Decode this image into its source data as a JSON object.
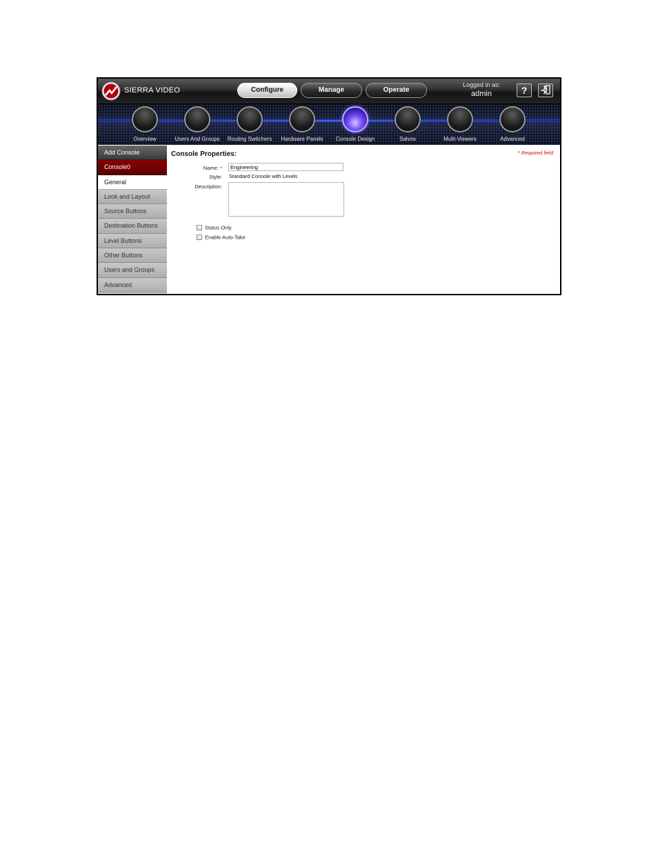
{
  "header": {
    "brand": "SIERRA VIDEO",
    "tabs": [
      {
        "label": "Configure",
        "active": true
      },
      {
        "label": "Manage",
        "active": false
      },
      {
        "label": "Operate",
        "active": false
      }
    ],
    "login_label": "Logged in as:",
    "login_user": "admin",
    "help_icon": "?",
    "logout_icon": "exit-running-man-icon"
  },
  "nav": {
    "items": [
      {
        "label": "Overview",
        "active": false
      },
      {
        "label": "Users And Groups",
        "active": false
      },
      {
        "label": "Routing Switchers",
        "active": false
      },
      {
        "label": "Hardware Panels",
        "active": false
      },
      {
        "label": "Console Design",
        "active": true
      },
      {
        "label": "Salvos",
        "active": false
      },
      {
        "label": "Multi-Viewers",
        "active": false
      },
      {
        "label": "Advanced",
        "active": false
      }
    ]
  },
  "sidebar": {
    "items": [
      {
        "label": "Add Console",
        "state": "head"
      },
      {
        "label": "Console0",
        "state": "sel"
      },
      {
        "label": "General",
        "state": "active"
      },
      {
        "label": "Look and Layout",
        "state": "normal"
      },
      {
        "label": "Source Buttons",
        "state": "normal"
      },
      {
        "label": "Destination Buttons",
        "state": "normal"
      },
      {
        "label": "Level Buttons",
        "state": "normal"
      },
      {
        "label": "Other Buttons",
        "state": "normal"
      },
      {
        "label": "Users and Groups",
        "state": "normal"
      },
      {
        "label": "Advanced",
        "state": "normal"
      }
    ]
  },
  "content": {
    "title": "Console Properties:",
    "required_note": "* Required field",
    "name_label": "Name:",
    "name_required": "*",
    "name_value": "Engineering",
    "style_label": "Style:",
    "style_value": "Standard Console with Levels",
    "description_label": "Description:",
    "description_value": "",
    "checkboxes": [
      {
        "label": "Status Only",
        "checked": false
      },
      {
        "label": "Enable Auto-Take",
        "checked": false
      }
    ]
  },
  "colors": {
    "accent_red": "#8a0000",
    "required_red": "#e00000",
    "active_orb": "#7a52ff"
  }
}
